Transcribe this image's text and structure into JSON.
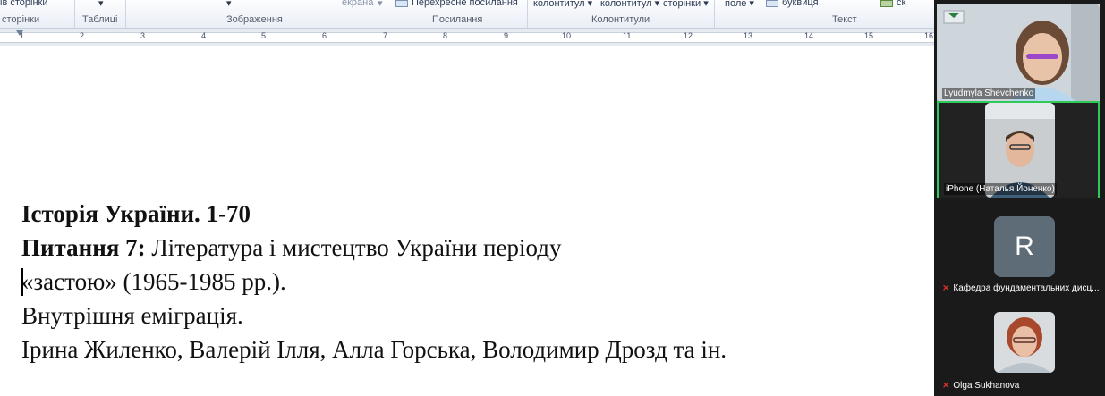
{
  "ribbon": {
    "top_items": [
      "ів сторінки",
      " екрана",
      "Перехресне посилання",
      "колонтитул",
      "колонтитул",
      "сторінки",
      "поле",
      "буквиця",
      "ск"
    ],
    "groups": [
      "сторінки",
      "Таблиці",
      "Зображення",
      "Посилання",
      "Колонтитули",
      "Текст"
    ]
  },
  "ruler": {
    "numbers": [
      "1",
      "2",
      "3",
      "4",
      "5",
      "6",
      "7",
      "8",
      "9",
      "10",
      "11",
      "12",
      "13",
      "14",
      "15",
      "16"
    ]
  },
  "document": {
    "title": "Історія України. 1-70",
    "q_label": "Питання 7:",
    "q_text": " Література і мистецтво України періоду",
    "line3": "«застою» (1965-1985 рр.).",
    "line4": "Внутрішня еміграція.",
    "line5": "Ірина Жиленко, Валерій Ілля, Алла Горська, Володимир Дрозд та ін."
  },
  "participants": [
    {
      "name": "Lyudmyla Shevchenko",
      "muted": false
    },
    {
      "name": "iPhone (Наталья Йоненко)",
      "muted": false,
      "speaking": true
    },
    {
      "name": "Кафедра фундаментальних дисц...",
      "muted": true,
      "initial": "R"
    },
    {
      "name": "Olga Sukhanova",
      "muted": true
    }
  ],
  "colors": {
    "speaking_border": "#2fcb58",
    "mute_icon": "#e0322d",
    "sidebar_bg": "#1a1a1a"
  }
}
